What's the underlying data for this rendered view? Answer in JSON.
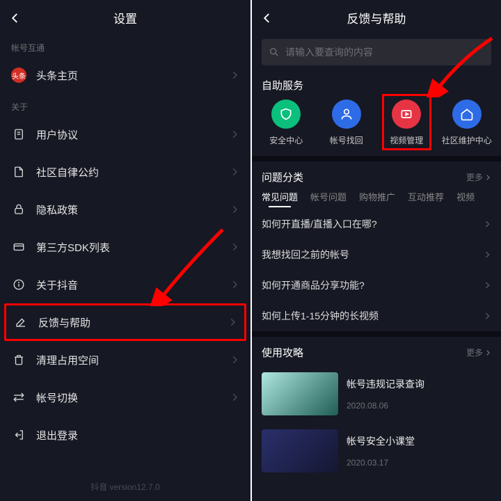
{
  "left": {
    "title": "设置",
    "section1_label": "帐号互通",
    "toutiao": "头条主页",
    "section2_label": "关于",
    "items": [
      "用户协议",
      "社区自律公约",
      "隐私政策",
      "第三方SDK列表",
      "关于抖音",
      "反馈与帮助",
      "清理占用空间",
      "帐号切换",
      "退出登录"
    ],
    "version": "抖音 version12.7.0",
    "avatar_text": "头条"
  },
  "right": {
    "title": "反馈与帮助",
    "search_placeholder": "请输入要查询的内容",
    "self_service_title": "自助服务",
    "services": [
      {
        "label": "安全中心",
        "color": "c-green"
      },
      {
        "label": "帐号找回",
        "color": "c-blue"
      },
      {
        "label": "视频管理",
        "color": "c-red"
      },
      {
        "label": "社区维护中心",
        "color": "c-blue2"
      }
    ],
    "category_title": "问题分类",
    "more": "更多",
    "tabs": [
      "常见问题",
      "帐号问题",
      "购物推广",
      "互动推荐",
      "视频"
    ],
    "questions": [
      "如何开直播/直播入口在哪?",
      "我想找回之前的帐号",
      "如何开通商品分享功能?",
      "如何上传1-15分钟的长视频"
    ],
    "guide_title": "使用攻略",
    "guides": [
      {
        "title": "帐号违规记录查询",
        "date": "2020.08.06"
      },
      {
        "title": "帐号安全小课堂",
        "date": "2020.03.17"
      }
    ]
  }
}
